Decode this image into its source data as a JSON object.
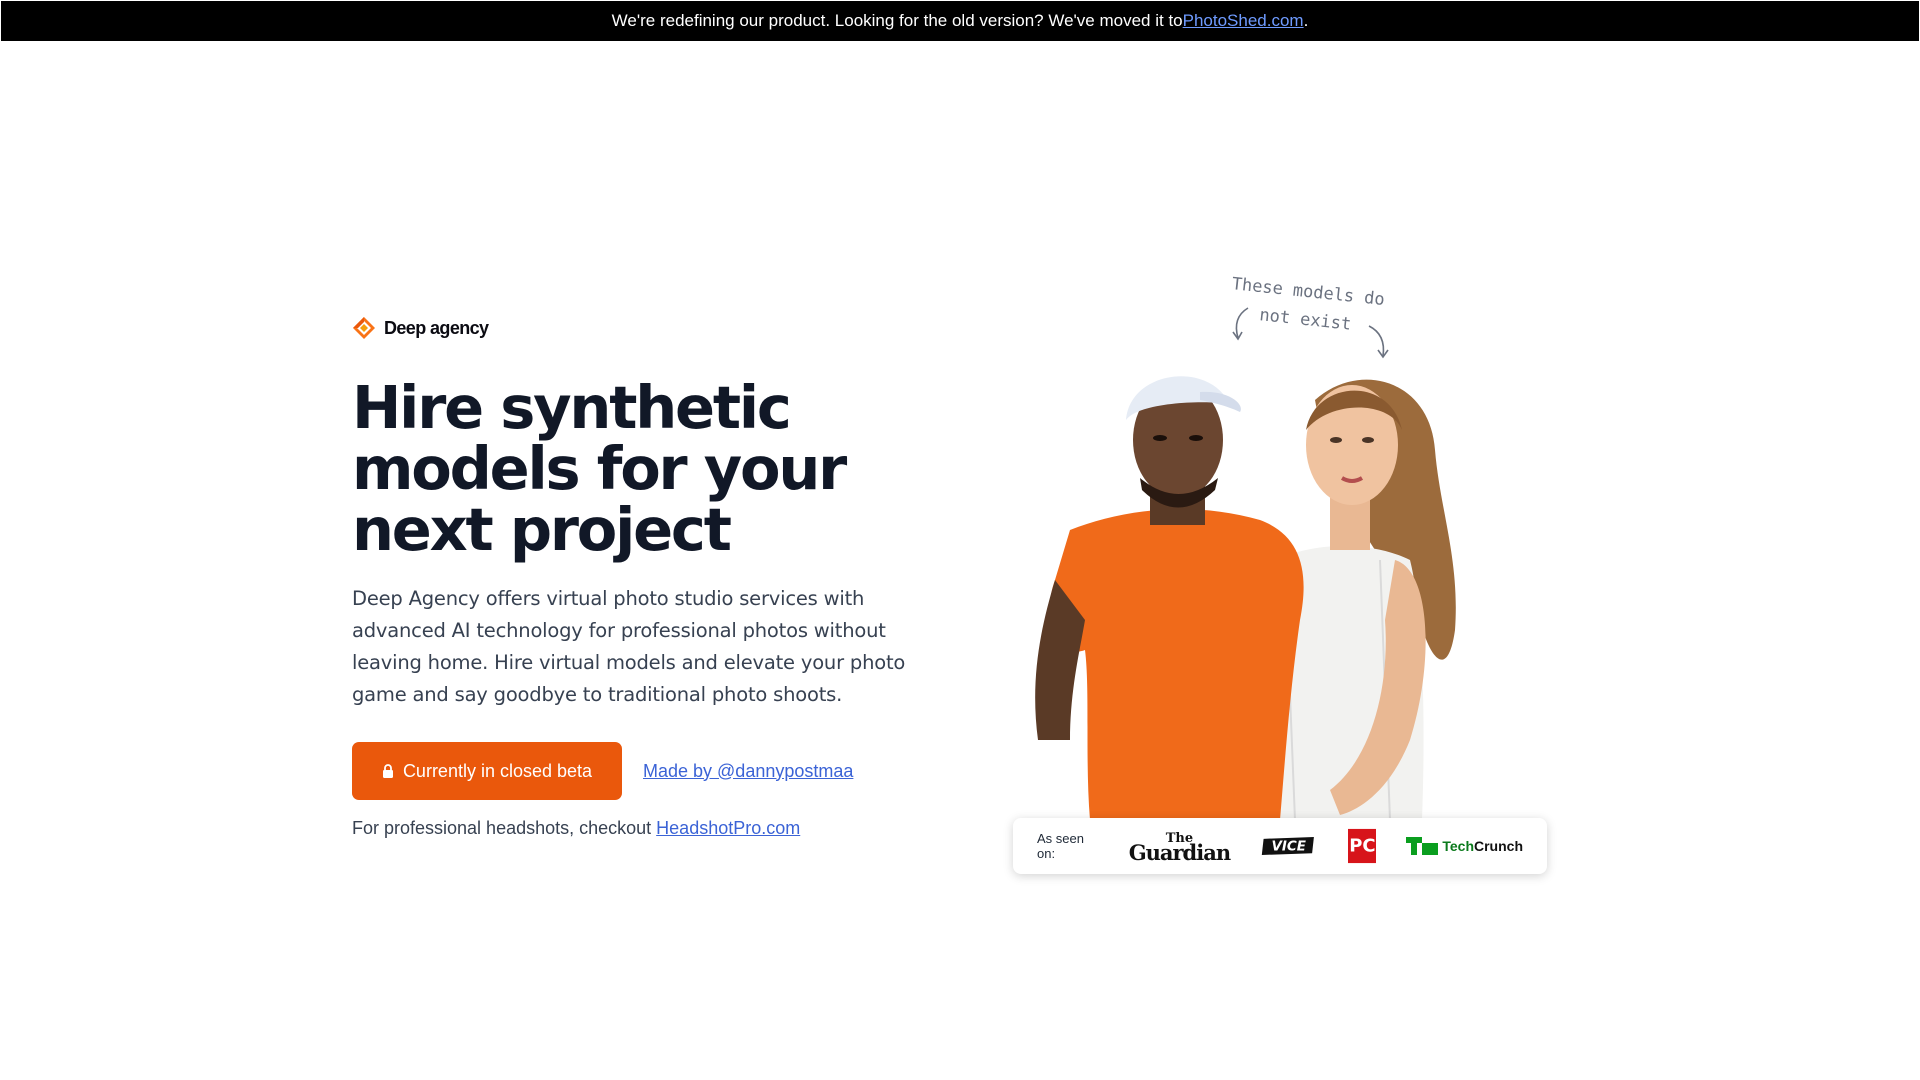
{
  "banner": {
    "text": "We're redefining our product. Looking for the old version? We've moved it to ",
    "link": "PhotoShed.com",
    "suffix": "."
  },
  "brand": {
    "name": "Deep agency",
    "icon": "deep-agency-logo-icon"
  },
  "hero": {
    "headline_lines": [
      "Hire synthetic",
      "models for your",
      "next project"
    ],
    "description": "Deep Agency offers virtual photo studio services with advanced AI technology for professional photos without leaving home. Hire virtual models and elevate your photo game and say goodbye to traditional photo shoots.",
    "cta_label": "Currently in closed beta",
    "cta_icon": "lock-icon",
    "made_by": "Made by @dannypostmaa",
    "headshot_text": "For professional headshots, checkout ",
    "headshot_link": "HeadshotPro.com"
  },
  "note": {
    "line1": "These models do",
    "line2": "not exist"
  },
  "press": {
    "label": "As seen on:",
    "logos": [
      "The Guardian",
      "VICE",
      "PC",
      "TechCrunch"
    ]
  },
  "colors": {
    "accent": "#ea580c",
    "link": "#3b63d6",
    "banner_bg": "#000000"
  }
}
